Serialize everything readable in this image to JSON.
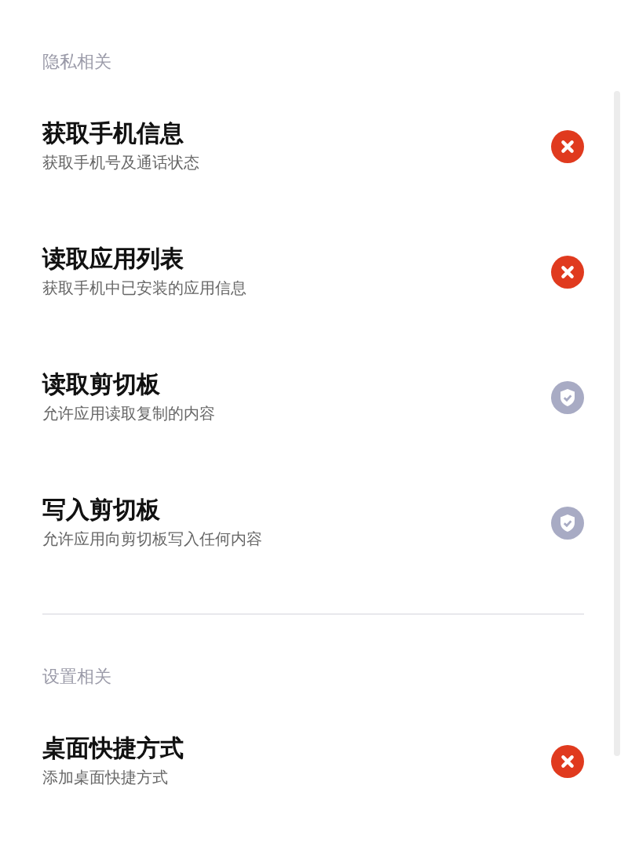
{
  "sections": [
    {
      "title": "隐私相关",
      "items": [
        {
          "title": "获取手机信息",
          "description": "获取手机号及通话状态",
          "allowed": false
        },
        {
          "title": "读取应用列表",
          "description": "获取手机中已安装的应用信息",
          "allowed": false
        },
        {
          "title": "读取剪切板",
          "description": "允许应用读取复制的内容",
          "allowed": true
        },
        {
          "title": "写入剪切板",
          "description": "允许应用向剪切板写入任何内容",
          "allowed": true
        }
      ]
    },
    {
      "title": "设置相关",
      "items": [
        {
          "title": "桌面快捷方式",
          "description": "添加桌面快捷方式",
          "allowed": false
        }
      ]
    }
  ]
}
